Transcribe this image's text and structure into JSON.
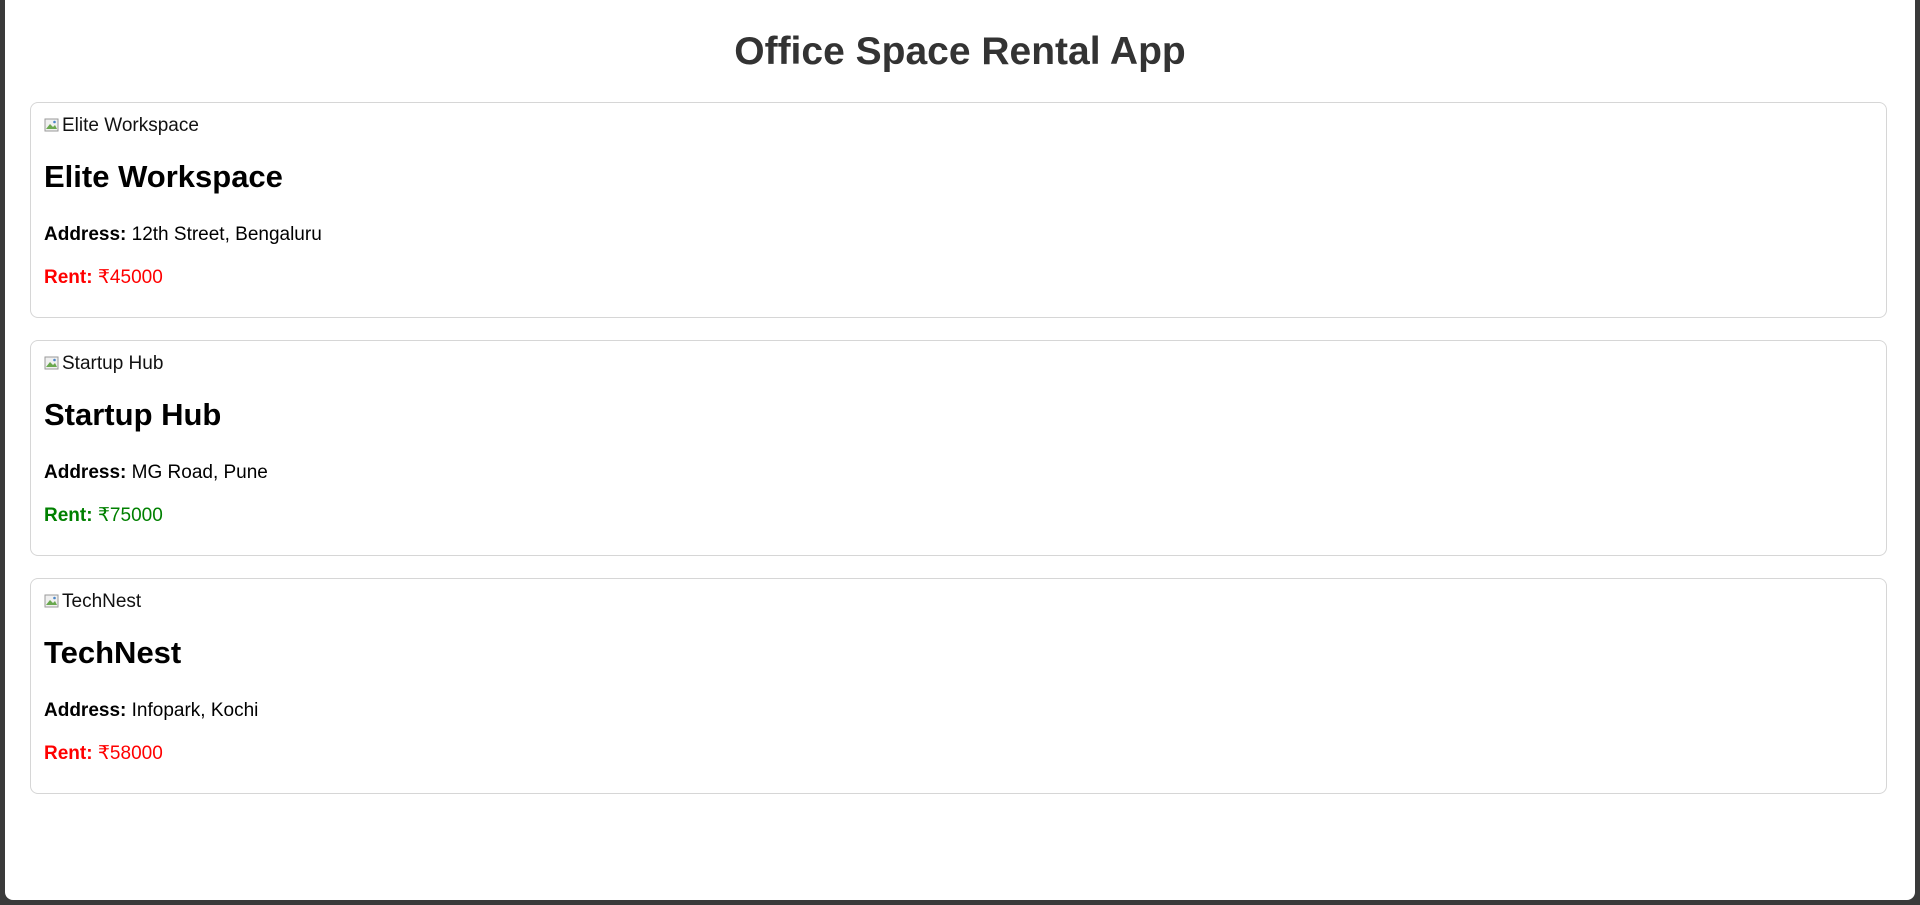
{
  "app": {
    "title": "Office Space Rental App"
  },
  "labels": {
    "address": "Address:",
    "rent": "Rent:"
  },
  "listings": [
    {
      "image_alt": "Elite Workspace",
      "name": "Elite Workspace",
      "address": "12th Street, Bengaluru",
      "rent": "₹45000",
      "rent_color": "#ff0000"
    },
    {
      "image_alt": "Startup Hub",
      "name": "Startup Hub",
      "address": "MG Road, Pune",
      "rent": "₹75000",
      "rent_color": "#008000"
    },
    {
      "image_alt": "TechNest",
      "name": "TechNest",
      "address": "Infopark, Kochi",
      "rent": "₹58000",
      "rent_color": "#ff0000"
    }
  ],
  "icons": {
    "broken_image": "broken-image-icon"
  }
}
